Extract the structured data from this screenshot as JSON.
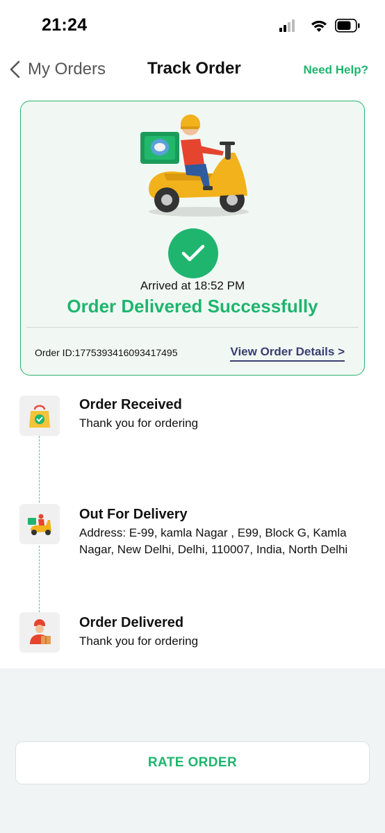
{
  "status_bar": {
    "time": "21:24"
  },
  "header": {
    "back_label": "My Orders",
    "title": "Track Order",
    "help_label": "Need Help?"
  },
  "card": {
    "arrived_text": "Arrived at 18:52 PM",
    "status_title": "Order Delivered Successfully",
    "order_id": "Order ID:1775393416093417495",
    "view_details_label": "View Order Details >"
  },
  "timeline": [
    {
      "title": "Order Received",
      "description": "Thank you for ordering",
      "icon": "shopping-bag-check-icon"
    },
    {
      "title": "Out For Delivery",
      "description": "Address: E-99, kamla Nagar , E99, Block G, Kamla Nagar, New Delhi, Delhi, 110007, India, North Delhi",
      "icon": "delivery-scooter-icon"
    },
    {
      "title": "Order Delivered",
      "description": "Thank you for ordering",
      "icon": "delivery-person-icon"
    }
  ],
  "footer": {
    "rate_label": "RATE ORDER"
  },
  "colors": {
    "accent": "#1fb56e",
    "link": "#3a3d6e",
    "card_bg": "#f1f8f4",
    "footer_bg": "#f0f4f4"
  }
}
